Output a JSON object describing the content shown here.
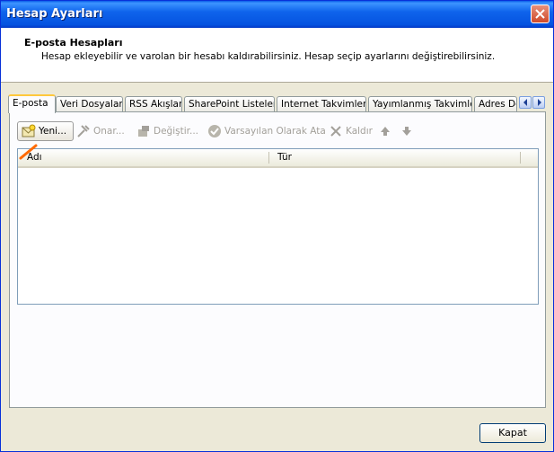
{
  "window": {
    "title": "Hesap Ayarları"
  },
  "header": {
    "title": "E-posta Hesapları",
    "description": "Hesap ekleyebilir ve varolan bir hesabı kaldırabilirsiniz. Hesap seçip ayarlarını değiştirebilirsiniz."
  },
  "tabs": [
    {
      "label": "E-posta",
      "active": true
    },
    {
      "label": "Veri Dosyaları"
    },
    {
      "label": "RSS Akışları"
    },
    {
      "label": "SharePoint Listeleri"
    },
    {
      "label": "Internet Takvimleri"
    },
    {
      "label": "Yayımlanmış Takvimler"
    },
    {
      "label": "Adres Defterleri"
    }
  ],
  "toolbar": {
    "new_label": "Yeni...",
    "repair_label": "Onar...",
    "change_label": "Değiştir...",
    "default_label": "Varsayılan Olarak Ata",
    "remove_label": "Kaldır"
  },
  "list": {
    "columns": [
      "Adı",
      "Tür"
    ],
    "rows": []
  },
  "footer": {
    "close_label": "Kapat"
  },
  "colors": {
    "title_bar": "#0553e0",
    "accent_tab": "#ffc83c",
    "cursor_mark": "#ff6a00",
    "disabled_text": "#a3a09a"
  },
  "icons": [
    "close-icon",
    "new-account-icon",
    "repair-icon",
    "change-icon",
    "set-default-icon",
    "remove-icon",
    "move-up-icon",
    "move-down-icon",
    "tab-scroll-left-icon",
    "tab-scroll-right-icon"
  ]
}
